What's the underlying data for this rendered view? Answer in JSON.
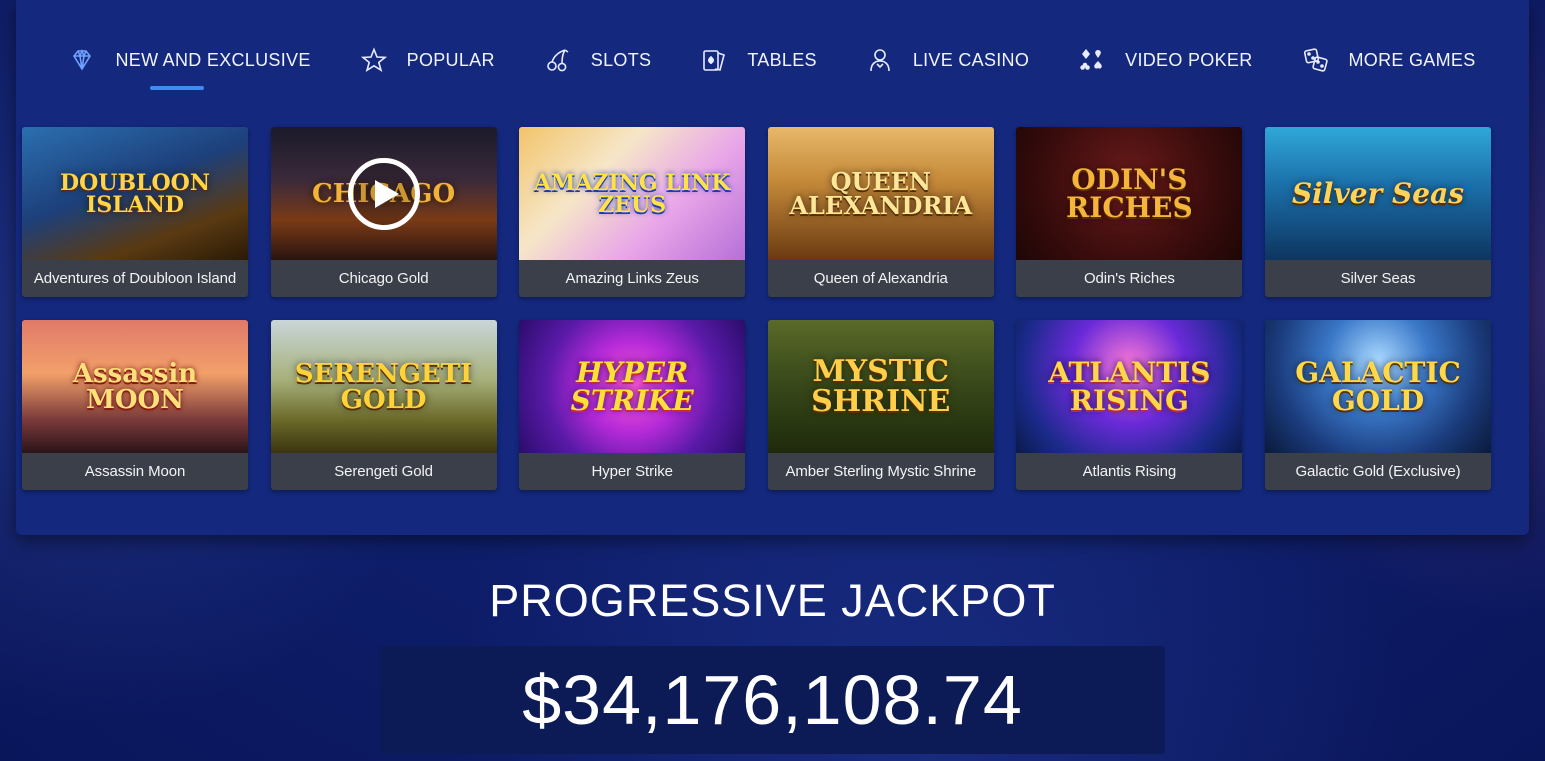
{
  "tabs": [
    {
      "label": "NEW AND EXCLUSIVE",
      "icon": "diamond-icon",
      "active": true
    },
    {
      "label": "POPULAR",
      "icon": "star-icon"
    },
    {
      "label": "SLOTS",
      "icon": "cherries-icon"
    },
    {
      "label": "TABLES",
      "icon": "playing-cards-icon"
    },
    {
      "label": "LIVE CASINO",
      "icon": "dealer-icon"
    },
    {
      "label": "VIDEO POKER",
      "icon": "card-suits-icon"
    },
    {
      "label": "MORE GAMES",
      "icon": "dice-icon"
    }
  ],
  "games": [
    {
      "name": "Adventures of Doubloon Island",
      "art": "DOUBLOON ISLAND"
    },
    {
      "name": "Chicago Gold",
      "art": "CHICAGO"
    },
    {
      "name": "Amazing Links Zeus",
      "art": "AMAZING LINK ZEUS"
    },
    {
      "name": "Queen of Alexandria",
      "art": "QUEEN ALEXANDRIA"
    },
    {
      "name": "Odin's Riches",
      "art": "ODIN'S RICHES"
    },
    {
      "name": "Silver Seas",
      "art": "Silver Seas"
    },
    {
      "name": "Assassin Moon",
      "art": "Assassin MOON"
    },
    {
      "name": "Serengeti Gold",
      "art": "SERENGETI GOLD"
    },
    {
      "name": "Hyper Strike",
      "art": "HYPER STRIKE"
    },
    {
      "name": "Amber Sterling Mystic Shrine",
      "art": "MYSTIC SHRINE"
    },
    {
      "name": "Atlantis Rising",
      "art": "ATLANTIS RISING"
    },
    {
      "name": "Galactic Gold (Exclusive)",
      "art": "GALACTIC GOLD"
    }
  ],
  "jackpot": {
    "title": "PROGRESSIVE JACKPOT",
    "amount": "$34,176,108.74"
  },
  "colors": {
    "accent": "#3d8cf0",
    "panel": "#14287e",
    "caption_bg": "#3a3f4a"
  }
}
